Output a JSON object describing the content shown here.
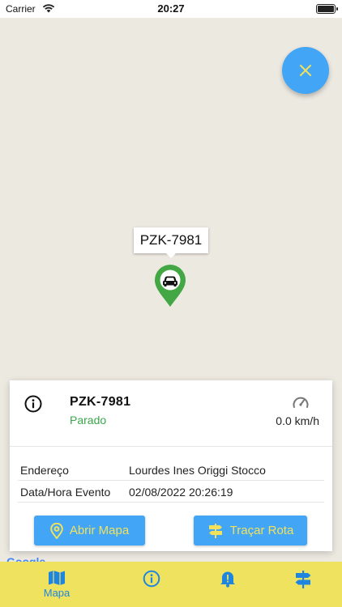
{
  "status_bar": {
    "carrier": "Carrier",
    "time": "20:27"
  },
  "map": {
    "marker_label": "PZK-7981",
    "google_logo": "Google"
  },
  "info_card": {
    "plate": "PZK-7981",
    "status": "Parado",
    "speed": "0.0 km/h",
    "rows": [
      {
        "label": "Endereço",
        "value": "Lourdes Ines Origgi Stocco"
      },
      {
        "label": "Data/Hora Evento",
        "value": "02/08/2022 20:26:19"
      }
    ],
    "buttons": {
      "open_map": "Abrir Mapa",
      "route": "Traçar Rota"
    }
  },
  "bottom_nav": {
    "map_label": "Mapa"
  },
  "colors": {
    "accent": "#42a5f5",
    "nav_background": "#efe25f",
    "button_text": "#f2e15d",
    "status_green": "#3aa64a",
    "marker_green": "#43a743"
  }
}
